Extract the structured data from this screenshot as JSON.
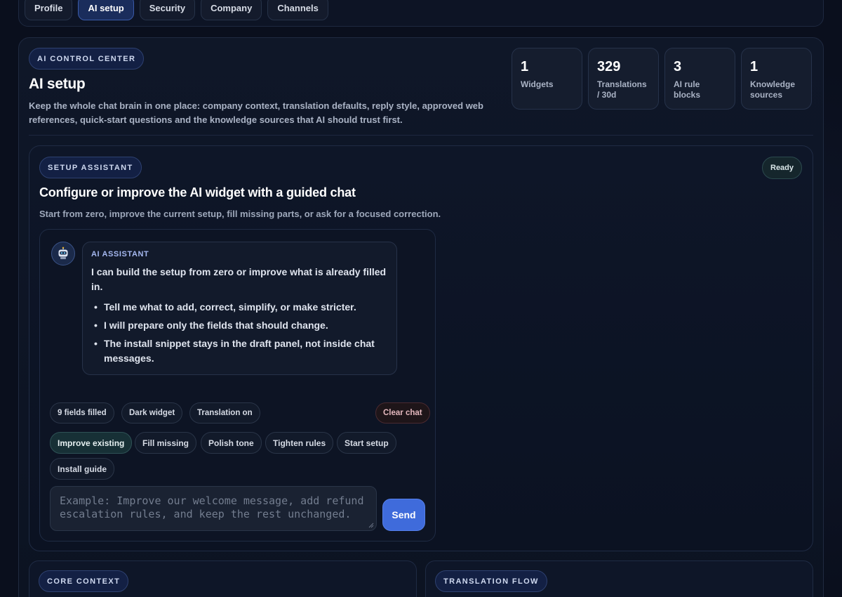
{
  "tabs": [
    {
      "label": "Profile",
      "active": false
    },
    {
      "label": "AI setup",
      "active": true
    },
    {
      "label": "Security",
      "active": false
    },
    {
      "label": "Company",
      "active": false
    },
    {
      "label": "Channels",
      "active": false
    }
  ],
  "header": {
    "kicker": "AI CONTROL CENTER",
    "title": "AI setup",
    "description": "Keep the whole chat brain in one place: company context, translation defaults, reply style, approved web references, quick-start questions and the knowledge sources that AI should trust first."
  },
  "stats": [
    {
      "value": "1",
      "label": "Widgets"
    },
    {
      "value": "329",
      "label": "Translations / 30d"
    },
    {
      "value": "3",
      "label": "AI rule blocks"
    },
    {
      "value": "1",
      "label": "Knowledge sources"
    }
  ],
  "assistant": {
    "kicker": "SETUP ASSISTANT",
    "status": "Ready",
    "title": "Configure or improve the AI widget with a guided chat",
    "description": "Start from zero, improve the current setup, fill missing parts, or ask for a focused correction.",
    "avatar_icon": "robot-icon",
    "message": {
      "sender": "AI ASSISTANT",
      "text": "I can build the setup from zero or improve what is already filled in.",
      "bullets": [
        "Tell me what to add, correct, simplify, or make stricter.",
        "I will prepare only the fields that should change.",
        "The install snippet stays in the draft panel, not inside chat messages."
      ]
    },
    "status_chips": [
      "9 fields filled",
      "Dark widget",
      "Translation on"
    ],
    "clear_label": "Clear chat",
    "actions": [
      {
        "label": "Improve existing",
        "active": true
      },
      {
        "label": "Fill missing",
        "active": false
      },
      {
        "label": "Polish tone",
        "active": false
      },
      {
        "label": "Tighten rules",
        "active": false
      },
      {
        "label": "Start setup",
        "active": false
      },
      {
        "label": "Install guide",
        "active": false
      }
    ],
    "input_placeholder": "Example: Improve our welcome message, add refund escalation rules, and keep the rest unchanged.",
    "send_label": "Send"
  },
  "sections": [
    {
      "kicker": "CORE CONTEXT"
    },
    {
      "kicker": "TRANSLATION FLOW"
    }
  ],
  "colors": {
    "background": "#0a0f1d",
    "accent": "#3f6bdb",
    "active_tab": "#1a2d5c"
  }
}
